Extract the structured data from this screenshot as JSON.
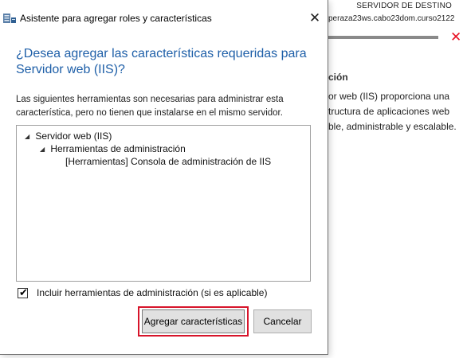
{
  "background_wizard": {
    "destination_label": "SERVIDOR DE DESTINO",
    "destination_server": "peraza23ws.cabo23dom.curso2122",
    "description_heading": "ción",
    "description_text": "or web (IIS) proporciona una\ntructura de aplicaciones web\nble, administrable y escalable."
  },
  "dialog": {
    "title": "Asistente para agregar roles y características",
    "heading": "¿Desea agregar las características requeridas para\nServidor web (IIS)?",
    "explanation": "Las siguientes herramientas son necesarias para administrar esta\ncaracterística, pero no tienen que instalarse en el mismo servidor.",
    "tree": {
      "level1": "Servidor web (IIS)",
      "level2": "Herramientas de administración",
      "level3": "[Herramientas] Consola de administración de IIS"
    },
    "include_tools_label": "Incluir herramientas de administración (si es aplicable)",
    "include_tools_checked": true,
    "add_features_label": "Agregar características",
    "cancel_label": "Cancelar"
  },
  "colors": {
    "heading_blue": "#1e5fa8",
    "highlight_red": "#d7142a",
    "error_red": "#e81123"
  }
}
